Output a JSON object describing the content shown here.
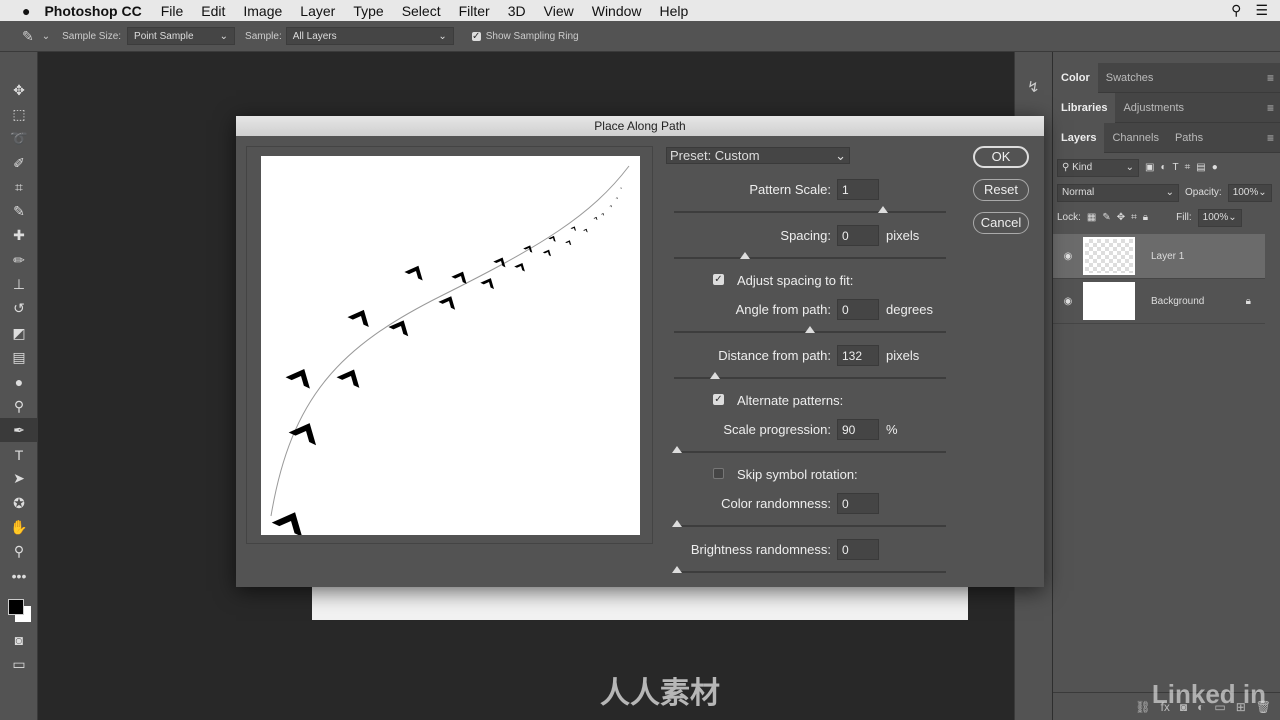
{
  "menubar": {
    "app": "Photoshop CC",
    "items": [
      "File",
      "Edit",
      "Image",
      "Layer",
      "Type",
      "Select",
      "Filter",
      "3D",
      "View",
      "Window",
      "Help"
    ]
  },
  "options": {
    "sample_size_label": "Sample Size:",
    "sample_size": "Point Sample",
    "sample_label": "Sample:",
    "sample": "All Layers",
    "show_ring": "Show Sampling Ring",
    "show_ring_checked": true
  },
  "dialog": {
    "title": "Place Along Path",
    "preset": "Preset: Custom",
    "ok": "OK",
    "reset": "Reset",
    "cancel": "Cancel",
    "fields": {
      "pattern_scale": {
        "label": "Pattern Scale:",
        "value": "1",
        "unit": "",
        "slider": 0.77
      },
      "spacing": {
        "label": "Spacing:",
        "value": "0",
        "unit": "pixels",
        "slider": 0.26
      },
      "adjust_spacing": {
        "label": "Adjust spacing to fit:",
        "checked": true
      },
      "angle": {
        "label": "Angle from path:",
        "value": "0",
        "unit": "degrees",
        "slider": 0.5
      },
      "distance": {
        "label": "Distance from path:",
        "value": "132",
        "unit": "pixels",
        "slider": 0.15
      },
      "alternate": {
        "label": "Alternate patterns:",
        "checked": true
      },
      "scale_prog": {
        "label": "Scale progression:",
        "value": "90",
        "unit": "%",
        "slider": 0.01
      },
      "skip_rotation": {
        "label": "Skip symbol rotation:",
        "checked": false
      },
      "color_rand": {
        "label": "Color randomness:",
        "value": "0",
        "slider": 0.01
      },
      "bright_rand": {
        "label": "Brightness randomness:",
        "value": "0",
        "slider": 0.01
      }
    }
  },
  "panels": {
    "tabs1": [
      "Color",
      "Swatches"
    ],
    "tabs2": [
      "Libraries",
      "Adjustments"
    ],
    "tabs3": [
      "Layers",
      "Channels",
      "Paths"
    ],
    "kind": "Kind",
    "blend": "Normal",
    "opacity_label": "Opacity:",
    "opacity": "100%",
    "lock_label": "Lock:",
    "fill_label": "Fill:",
    "fill": "100%",
    "layers": [
      {
        "name": "Layer 1",
        "selected": true
      },
      {
        "name": "Background",
        "locked": true
      }
    ]
  },
  "watermark": "人人素材",
  "brand": "Linked in"
}
